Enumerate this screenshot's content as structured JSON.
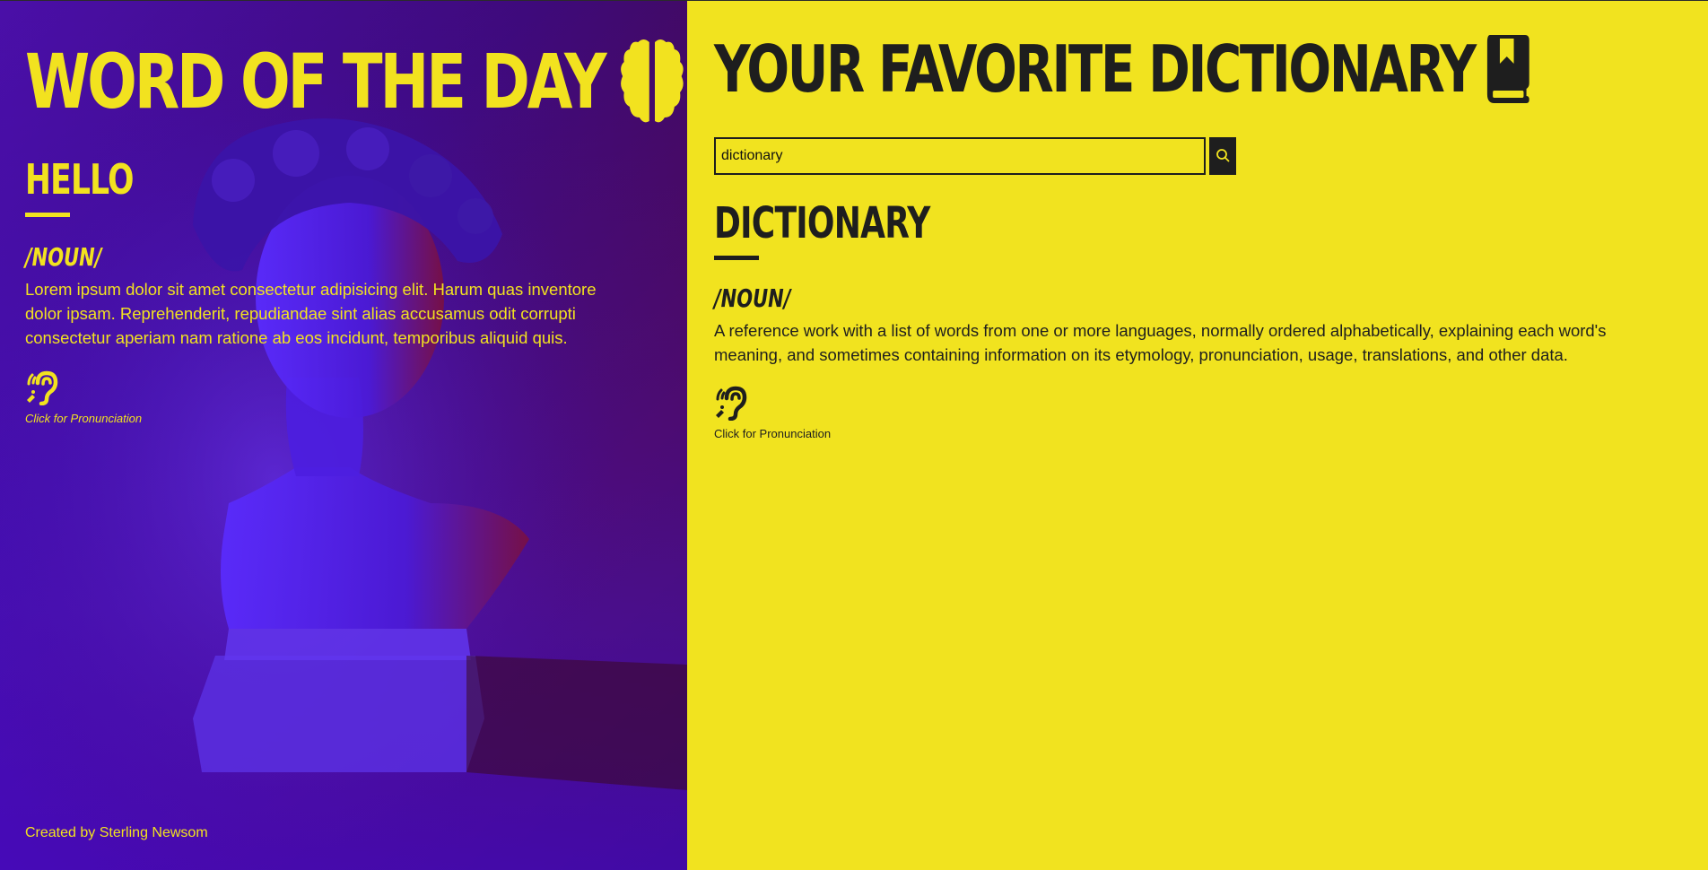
{
  "word_of_day": {
    "title": "WORD OF THE DAY",
    "word": "HELLO",
    "part_of_speech": "/NOUN/",
    "definition": "Lorem ipsum dolor sit amet consectetur adipisicing elit. Harum quas inventore dolor ipsam. Reprehenderit, repudiandae sint alias accusamus odit corrupti consectetur aperiam nam ratione ab eos incidunt, temporibus aliquid quis.",
    "pronunciation_label": "Click for Pronunciation",
    "icons": {
      "title": "brain-icon",
      "pronunciation": "ear-listen-icon"
    }
  },
  "footer": {
    "credit": "Created by Sterling Newsom"
  },
  "dictionary": {
    "title": "YOUR FAVORITE DICTIONARY",
    "search": {
      "value": "dictionary",
      "button_icon": "search-icon"
    },
    "word": "DICTIONARY",
    "part_of_speech": "/NOUN/",
    "definition": "A reference work with a list of words from one or more languages, normally ordered alphabetically, explaining each word's meaning, and sometimes containing information on its etymology, pronunciation, usage, translations, and other data.",
    "pronunciation_label": "Click for Pronunciation",
    "icons": {
      "title": "book-icon",
      "pronunciation": "ear-listen-icon"
    }
  },
  "colors": {
    "accent_yellow": "#f2e21f",
    "dark": "#1e1e1e",
    "left_bg_purple": "#4a0fa8"
  }
}
